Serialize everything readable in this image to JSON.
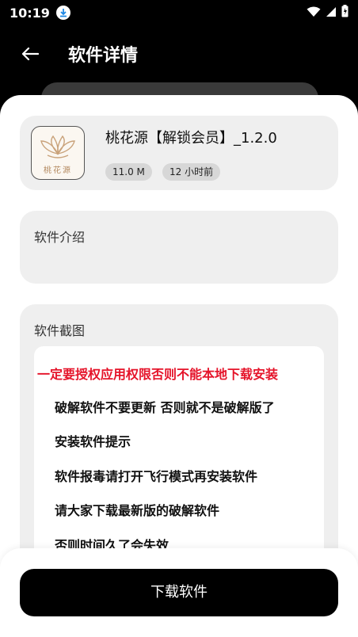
{
  "status_bar": {
    "time": "10:19"
  },
  "header": {
    "title": "软件详情"
  },
  "app": {
    "name": "桃花源【解锁会员】_1.2.0",
    "size": "11.0 M",
    "updated": "12 小时前",
    "icon_text": "桃花源"
  },
  "intro": {
    "title": "软件介绍"
  },
  "screenshots": {
    "title": "软件截图",
    "lines": [
      "一定要授权应用权限否则不能本地下载安装",
      "破解软件不要更新 否则就不是破解版了",
      "安装软件提示",
      "软件报毒请打开飞行模式再安装软件",
      "请大家下载最新版的破解软件",
      "否则时间久了会失效"
    ]
  },
  "actions": {
    "download_label": "下载软件"
  },
  "colors": {
    "warning": "#e5142a",
    "primary": "#000000"
  }
}
